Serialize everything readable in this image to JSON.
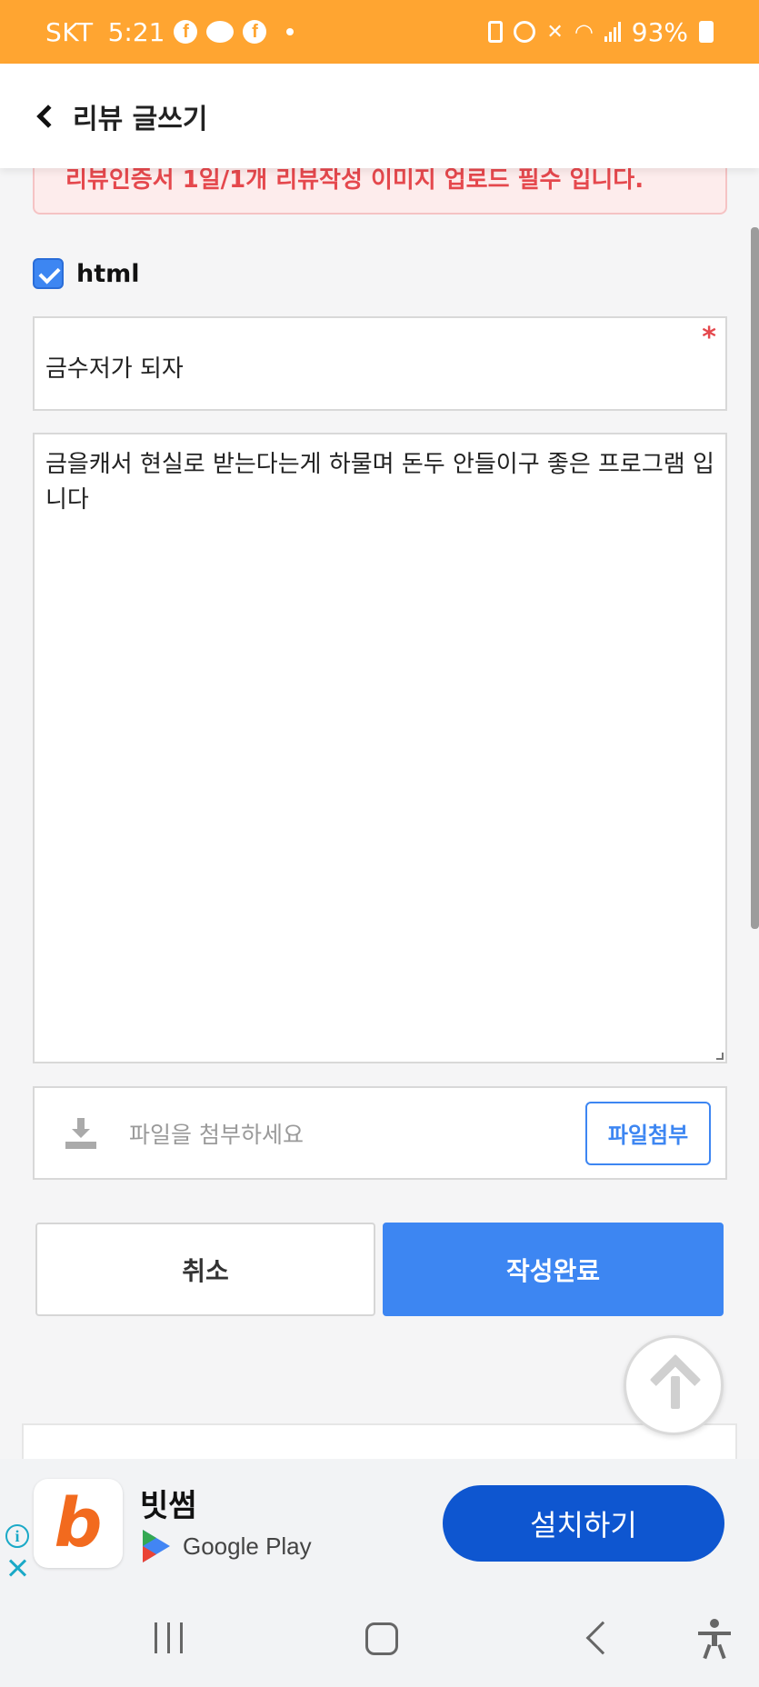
{
  "status_bar": {
    "carrier": "SKT",
    "time": "5:21",
    "battery": "93%"
  },
  "header": {
    "title": "리뷰 글쓰기"
  },
  "notice": {
    "text": "리뷰인증서 1일/1개 리뷰작성 이미지 업로드 필수 입니다."
  },
  "html_option": {
    "label": "html",
    "checked": true
  },
  "form": {
    "subject_value": "금수저가 되자",
    "required_mark": "*",
    "content_value": "금을캐서 현실로 받는다는게 하물며 돈두 안들이구 좋은 프로그램 입니다",
    "file_placeholder": "파일을 첨부하세요",
    "file_button": "파일첨부"
  },
  "actions": {
    "cancel": "취소",
    "submit": "작성완료"
  },
  "ad": {
    "app_name": "빗썸",
    "logo_letter": "b",
    "store": "Google Play",
    "install": "설치하기",
    "info": "i"
  },
  "colors": {
    "status_bar": "#ffa531",
    "accent": "#3d86f2",
    "ad_button": "#0e56d0",
    "notice_text": "#e5484d"
  }
}
